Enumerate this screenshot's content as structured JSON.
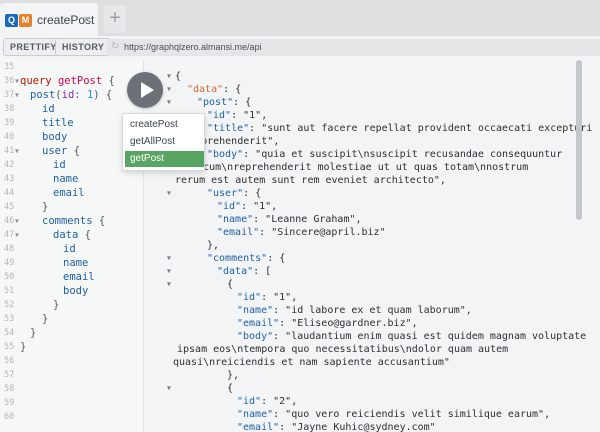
{
  "tabbar": {
    "badge_q": "Q",
    "badge_m": "M",
    "tab_title": "createPost",
    "close_glyph": "×",
    "add_glyph": "+"
  },
  "toolbar": {
    "prettify_label": "PRETTIFY",
    "history_label": "HISTORY",
    "url": "https://graphqlzero.almansi.me/api"
  },
  "editor": {
    "line_numbers": [
      "35",
      "36",
      "37",
      "38",
      "39",
      "40",
      "41",
      "42",
      "43",
      "44",
      "45",
      "46",
      "47",
      "48",
      "49",
      "50",
      "51",
      "52",
      "53",
      "54",
      "55",
      "56",
      "57",
      "58",
      "59",
      "60"
    ]
  },
  "operations": {
    "items": [
      "createPost",
      "getAllPost",
      "getPost"
    ],
    "selected": "getPost"
  },
  "result": {
    "data_key": "\"data\"",
    "post_key": "\"post\"",
    "id_key": "\"id\"",
    "post_id": "\"1\"",
    "title_key": "\"title\"",
    "post_title_1": "\"sunt aut facere repellat provident occaecati excepturi",
    "post_title_2": "\\nreprehenderit\",",
    "body_key": "\"body\"",
    "post_body_1": "\"quia et suscipit\\nsuscipit recusandae consequuntur",
    "post_body_2": "a et cum\\nreprehenderit molestiae ut ut quas totam\\nnostrum",
    "post_body_3": "rerum est autem sunt rem eveniet architecto\",",
    "user_key": "\"user\"",
    "user_id": "\"1\"",
    "name_key": "\"name\"",
    "user_name": "\"Leanne Graham\"",
    "email_key": "\"email\"",
    "user_email": "\"Sincere@april.biz\"",
    "comments_key": "\"comments\"",
    "c1_id": "\"1\"",
    "c1_name": "\"id labore ex et quam laborum\"",
    "c1_email": "\"Eliseo@gardner.biz\"",
    "c1_body_1": "\"laudantium enim quasi est quidem magnam voluptate",
    "c1_body_2": "ipsam eos\\ntempora quo necessitatibus\\ndolor quam autem",
    "c1_body_3": "quasi\\nreiciendis et nam sapiente accusantium\"",
    "c2_id": "\"2\"",
    "c2_name": "\"quo vero reiciendis velit similique earum\"",
    "c2_email": "\"Jayne_Kuhic@sydney.com\""
  },
  "colors": {
    "selected_item_bg": "#58a563",
    "play_button": "#6c7178",
    "badge_q": "#1a68c0",
    "badge_m": "#e4812a"
  }
}
